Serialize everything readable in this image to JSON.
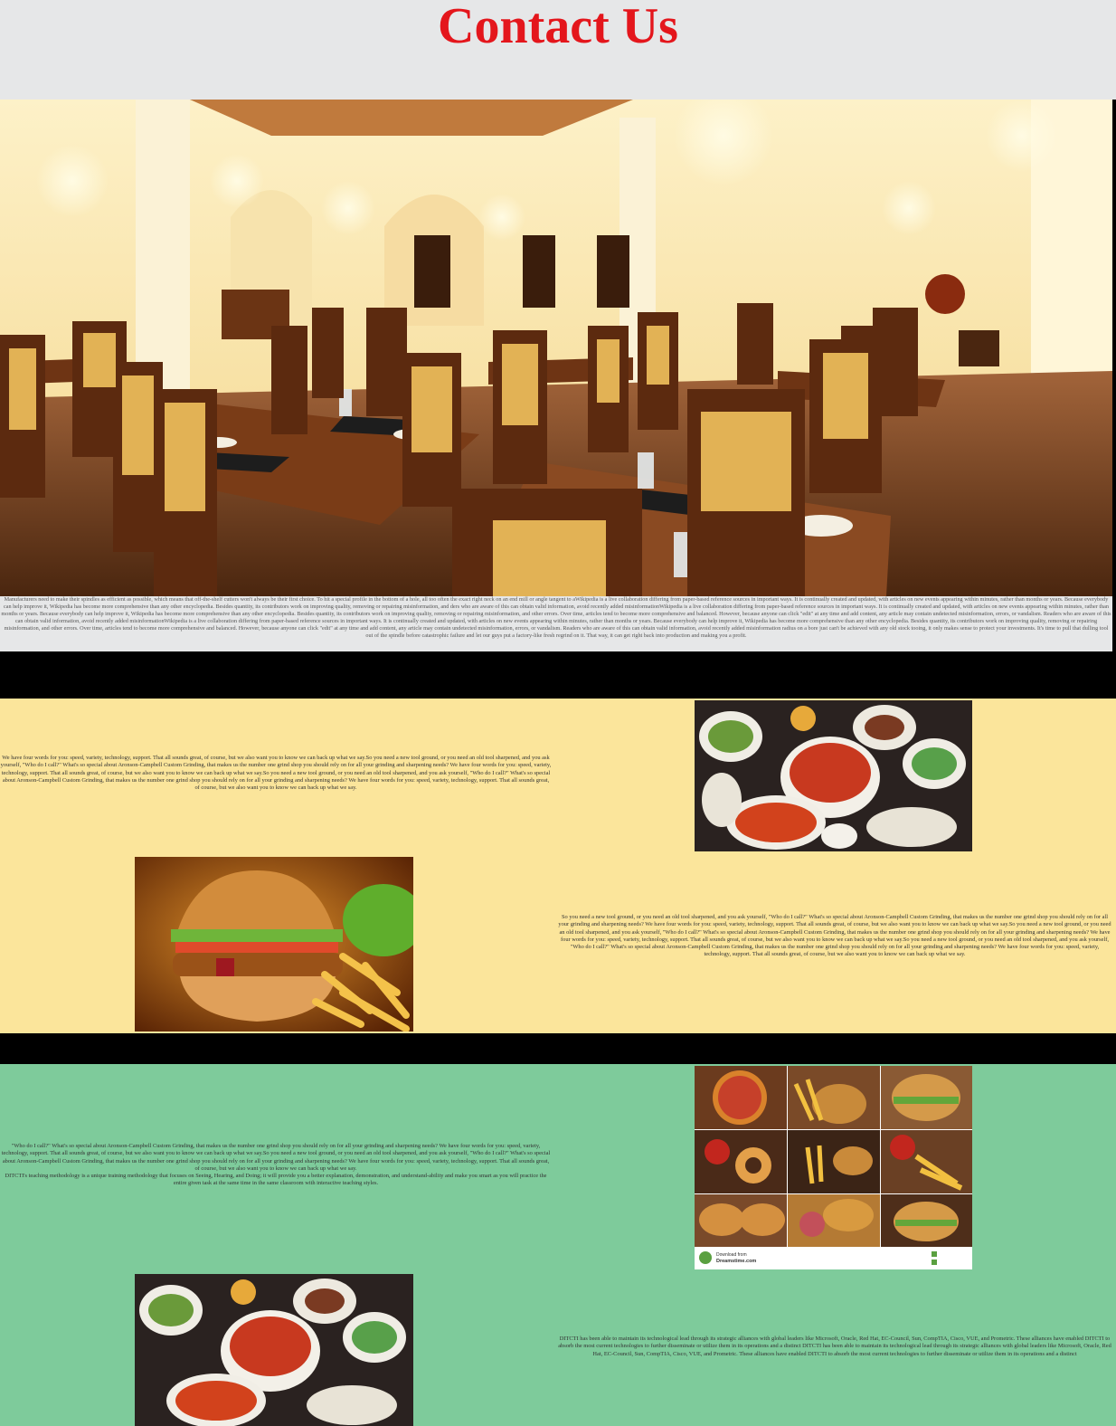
{
  "header": {
    "title": "Contact Us"
  },
  "hero": {
    "caption": "Manufacturers need to make their spindles as efficient as possible, which means that off-the-shelf cutters won't always be their first choice. To hit a special profile in the bottom of a hole, all too often the exact right neck on an end mill or angle tangent to aWikipedia is a live collaboration differing from paper-based reference sources in important ways. It is continually created and updated, with articles on new events appearing within minutes, rather than months or years. Because everybody can help improve it, Wikipedia has become more comprehensive than any other encyclopedia. Besides quantity, its contributors work on improving quality, removing or repairing misinformation, and ders who are aware of this can obtain valid information, avoid recently added misinformationWikipedia is a live collaboration differing from paper-based reference sources in important ways. It is continually created and updated, with articles on new events appearing within minutes, rather than months or years. Because everybody can help improve it, Wikipedia has become more comprehensive than any other encyclopedia. Besides quantity, its contributors work on improving quality, removing or repairing misinformation, and other errors. Over time, articles tend to become more comprehensive and balanced. However, because anyone can click \"edit\" at any time and add content, any article may contain undetected misinformation, errors, or vandalism. Readers who are aware of this can obtain valid information, avoid recently added misinformationWikipedia is a live collaboration differing from paper-based reference sources in important ways. It is continually created and updated, with articles on new events appearing within minutes, rather than months or years. Because everybody can help improve it, Wikipedia has become more comprehensive than any other encyclopedia. Besides quantity, its contributors work on improving quality, removing or repairing misinformation, and other errors. Over time, articles tend to become more comprehensive and balanced. However, because anyone can click \"edit\" at any time and add content, any article may contain undetected misinformation, errors, or vandalism. Readers who are aware of this can obtain valid information, avoid recently added misinformation radius on a bore just can't be achieved with any old stock tooing, it only makes sense to protect your investments. It's time to pull that dulling tool out of the spindle before catastrophic failure and let our guys put a factory-like fresh regrind on it. That way, it can get right back into production and making you a profit."
  },
  "section1": {
    "text": "We have four words for you: speed, variety, technology, support. That all sounds great, of course, but we also want you to know we can back up what we say.So you need a new tool ground, or you need an old tool sharpened, and you ask yourself, \"Who do I call?\" What's so special about Aronson-Campbell Custom Grinding, that makes us the number one grind shop you should rely on for all your grinding and sharpening needs? We have four words for you: speed, variety, technology, support. That all sounds great, of course, but we also want you to know we can back up what we say.So you need a new tool ground, or you need an old tool sharpened, and you ask yourself, \"Who do I call?\" What's so special about Aronson-Campbell Custom Grinding, that makes us the number one grind shop you should rely on for all your grinding and sharpening needs? We have four words for you: speed, variety, technology, support. That all sounds great, of course, but we also want you to know we can back up what we say."
  },
  "section2": {
    "text": "So you need a new tool ground, or you need an old tool sharpened, and you ask yourself, \"Who do I call?\" What's so special about Aronson-Campbell Custom Grinding, that makes us the number one grind shop you should rely on for all your grinding and sharpening needs? We have four words for you: speed, variety, technology, support. That all sounds great, of course, but we also want you to know we can back up what we say.So you need a new tool ground, or you need an old tool sharpened, and you ask yourself, \"Who do I call?\" What's so special about Aronson-Campbell Custom Grinding, that makes us the number one grind shop you should rely on for all your grinding and sharpening needs? We have four words for you: speed, variety, technology, support. That all sounds great, of course, but we also want you to know we can back up what we say.So you need a new tool ground, or you need an old tool sharpened, and you ask yourself, \"Who do I call?\" What's so special about Aronson-Campbell Custom Grinding, that makes us the number one grind shop you should rely on for all your grinding and sharpening needs? We have four words for you: speed, variety, technology, support. That all sounds great, of course, but we also want you to know we can back up what we say."
  },
  "section3": {
    "text": "\"Who do I call?\" What's so special about Aronson-Campbell Custom Grinding, that makes us the number one grind shop you should rely on for all your grinding and sharpening needs? We have four words for you: speed, variety, technology, support. That all sounds great, of course, but we also want you to know we can back up what we say.So you need a new tool ground, or you need an old tool sharpened, and you ask yourself, \"Who do I call?\" What's so special about Aronson-Campbell Custom Grinding, that makes us the number one grind shop you should rely on for all your grinding and sharpening needs? We have four words for you: speed, variety, technology, support. That all sounds great, of course, but we also want you to know we can back up what we say.",
    "text2": "DITCTI's teaching methodology is a unique training methodology that focuses on Seeing, Hearing, and Doing; it will provide you a better explanation, demonstration, and understand-ability and make you smart as you will practice the entire given task at the same time in the same classroom with interactive teaching styles."
  },
  "section4": {
    "text": "DITCTI has been able to maintain its technological lead through its strategic alliances with global leaders like Microsoft, Oracle, Red Hat, EC-Council, Sun, CompTIA, Cisco, VUE, and Prometric. These alliances have enabled DITCTI to absorb the most current technologies to further disseminate or utilize them in its operations and a distinct DITCTI has been able to maintain its technological lead through its strategic alliances with global leaders like Microsoft, Oracle, Red Hat, EC-Council, Sun, CompTIA, Cisco, VUE, and Prometric. These alliances have enabled DITCTI to absorb the most current technologies to further disseminate or utilize them in its operations and a distinct"
  },
  "watermark": {
    "line1": "Download from",
    "line2": "Dreamstime.com"
  }
}
